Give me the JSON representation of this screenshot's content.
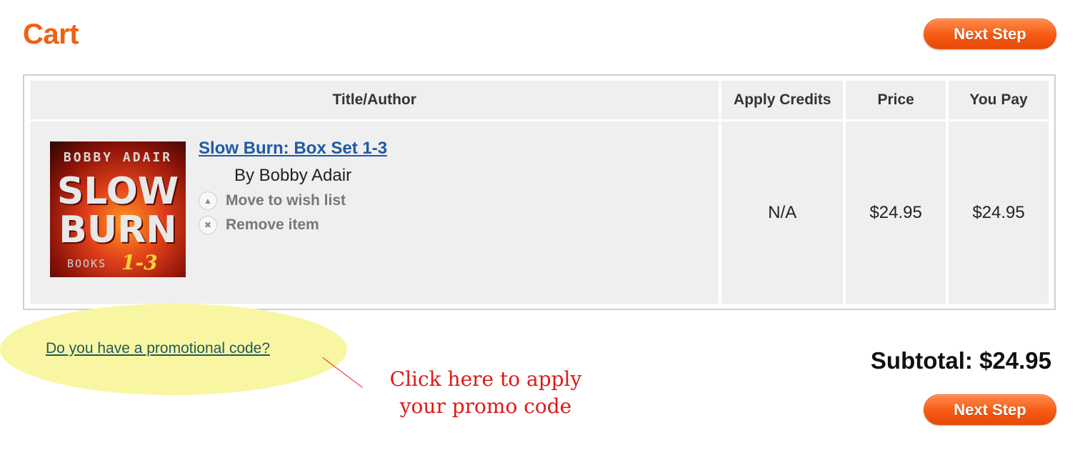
{
  "page": {
    "title": "Cart"
  },
  "buttons": {
    "next_step": "Next Step"
  },
  "table": {
    "headers": {
      "title_author": "Title/Author",
      "apply_credits": "Apply Credits",
      "price": "Price",
      "you_pay": "You Pay"
    },
    "items": [
      {
        "cover": {
          "author_text": "BOBBY ADAIR",
          "title_line1": "SLOW",
          "title_line2": "BURN",
          "books_text": "BOOKS",
          "number_text": "1-3"
        },
        "title": "Slow Burn: Box Set 1-3",
        "author": "By Bobby Adair",
        "actions": {
          "wish_list": "Move to wish list",
          "remove": "Remove item"
        },
        "credits": "N/A",
        "price": "$24.95",
        "you_pay": "$24.95"
      }
    ]
  },
  "promo": {
    "link": "Do you have a promotional code?",
    "annotation_line1": "Click here to apply",
    "annotation_line2": "your promo code"
  },
  "summary": {
    "subtotal": "Subtotal: $24.95"
  },
  "colors": {
    "accent": "#f0600f",
    "link": "#1f5aa6",
    "annotation": "#e01818",
    "highlight": "#f9f6a3"
  }
}
